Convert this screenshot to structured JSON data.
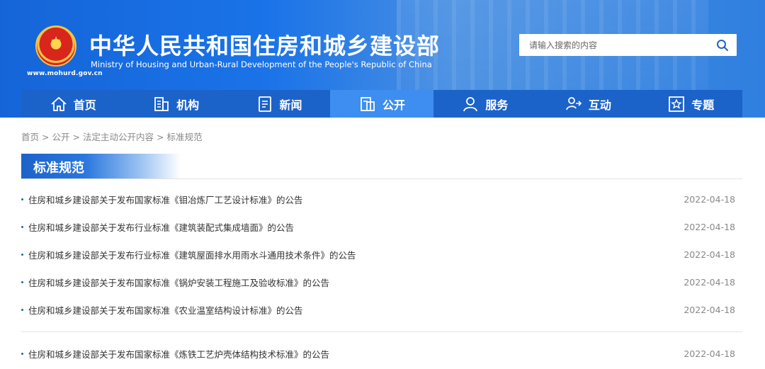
{
  "header": {
    "title": "中华人民共和国住房和城乡建设部",
    "subtitle": "Ministry of Housing and Urban-Rural Development of the People's Republic of China",
    "domain": "www.mohurd.gov.cn",
    "search_placeholder": "请输入搜索的内容"
  },
  "nav": [
    {
      "label": "首页",
      "icon": "home-icon"
    },
    {
      "label": "机构",
      "icon": "building-icon"
    },
    {
      "label": "新闻",
      "icon": "news-icon"
    },
    {
      "label": "公开",
      "icon": "documents-icon",
      "active": true
    },
    {
      "label": "服务",
      "icon": "user-service-icon"
    },
    {
      "label": "互动",
      "icon": "interaction-icon"
    },
    {
      "label": "专题",
      "icon": "star-topic-icon"
    }
  ],
  "breadcrumb": [
    "首页",
    "公开",
    "法定主动公开内容",
    "标准规范"
  ],
  "section": {
    "title": "标准规范"
  },
  "list": [
    {
      "title": "住房和城乡建设部关于发布国家标准《钼冶炼厂工艺设计标准》的公告",
      "date": "2022-04-18"
    },
    {
      "title": "住房和城乡建设部关于发布行业标准《建筑装配式集成墙面》的公告",
      "date": "2022-04-18"
    },
    {
      "title": "住房和城乡建设部关于发布行业标准《建筑屋面排水用雨水斗通用技术条件》的公告",
      "date": "2022-04-18"
    },
    {
      "title": "住房和城乡建设部关于发布国家标准《锅炉安装工程施工及验收标准》的公告",
      "date": "2022-04-18"
    },
    {
      "title": "住房和城乡建设部关于发布国家标准《农业温室结构设计标准》的公告",
      "date": "2022-04-18"
    }
  ],
  "list2": [
    {
      "title": "住房和城乡建设部关于发布国家标准《炼铁工艺炉壳体结构技术标准》的公告",
      "date": "2022-04-18"
    }
  ],
  "colors": {
    "primary": "#1c63c9",
    "active_tab": "#3d8ef0",
    "header_bg": "#1a73e8"
  }
}
